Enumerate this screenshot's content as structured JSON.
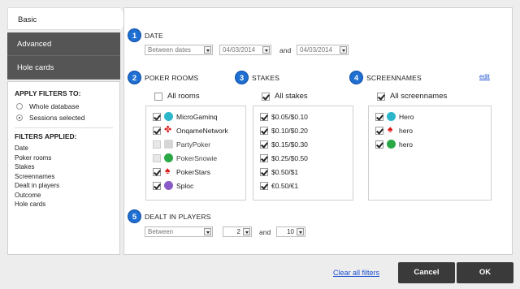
{
  "tabs": [
    {
      "label": "Basic",
      "active": true
    },
    {
      "label": "Advanced",
      "active": false
    },
    {
      "label": "Hole cards",
      "active": false
    }
  ],
  "apply_filters": {
    "heading": "APPLY FILTERS TO:",
    "options": [
      {
        "label": "Whole database",
        "selected": false
      },
      {
        "label": "Sessions selected",
        "selected": true
      }
    ]
  },
  "filters_applied": {
    "heading": "FILTERS APPLIED:",
    "items": [
      "Date",
      "Poker rooms",
      "Stakes",
      "Screennames",
      "Dealt in players",
      "Outcome",
      "Hole cards"
    ]
  },
  "date": {
    "number": "1",
    "title": "DATE",
    "mode": "Between dates",
    "from": "04/03/2014",
    "and_label": "and",
    "to": "04/03/2014"
  },
  "poker_rooms": {
    "number": "2",
    "title": "POKER ROOMS",
    "all_label": "All rooms",
    "all_checked": false,
    "items": [
      {
        "label": "MicroGaminq",
        "checked": true,
        "icon": "microgaming-icon"
      },
      {
        "label": "OnqameNetwork",
        "checked": true,
        "icon": "ongame-icon"
      },
      {
        "label": "PartyPoker",
        "checked": false,
        "icon": "partypoker-icon"
      },
      {
        "label": "PokerSnowie",
        "checked": false,
        "icon": "pokersnowie-icon"
      },
      {
        "label": "PokerStars",
        "checked": true,
        "icon": "pokerstars-icon"
      },
      {
        "label": "Sploc",
        "checked": true,
        "icon": "sploc-icon"
      }
    ]
  },
  "stakes": {
    "number": "3",
    "title": "STAKES",
    "all_label": "All stakes",
    "all_checked": true,
    "items": [
      {
        "label": "$0.05/$0.10",
        "checked": true
      },
      {
        "label": "$0.10/$0.20",
        "checked": true
      },
      {
        "label": "$0.15/$0.30",
        "checked": true
      },
      {
        "label": "$0.25/$0.50",
        "checked": true
      },
      {
        "label": "$0.50/$1",
        "checked": true
      },
      {
        "label": "€0.50/€1",
        "checked": true
      }
    ]
  },
  "screennames": {
    "number": "4",
    "title": "SCREENNAMES",
    "edit_label": "edit",
    "all_label": "All screennames",
    "all_checked": true,
    "items": [
      {
        "label": "Hero",
        "checked": true,
        "icon": "microgaming-icon"
      },
      {
        "label": "hero",
        "checked": true,
        "icon": "pokerstars-icon"
      },
      {
        "label": "hero",
        "checked": true,
        "icon": "pokersnowie-icon"
      }
    ]
  },
  "dealt_in": {
    "number": "5",
    "title": "DEALT IN PLAYERS",
    "mode": "Between",
    "min": "2",
    "and_label": "and",
    "max": "10"
  },
  "footer": {
    "clear_label": "Clear all filters",
    "cancel_label": "Cancel",
    "ok_label": "OK"
  },
  "colors": {
    "accent_blue": "#1e6fd1",
    "tab_dark": "#555555",
    "button_dark": "#3a3a3a",
    "link": "#1a4fd0"
  }
}
